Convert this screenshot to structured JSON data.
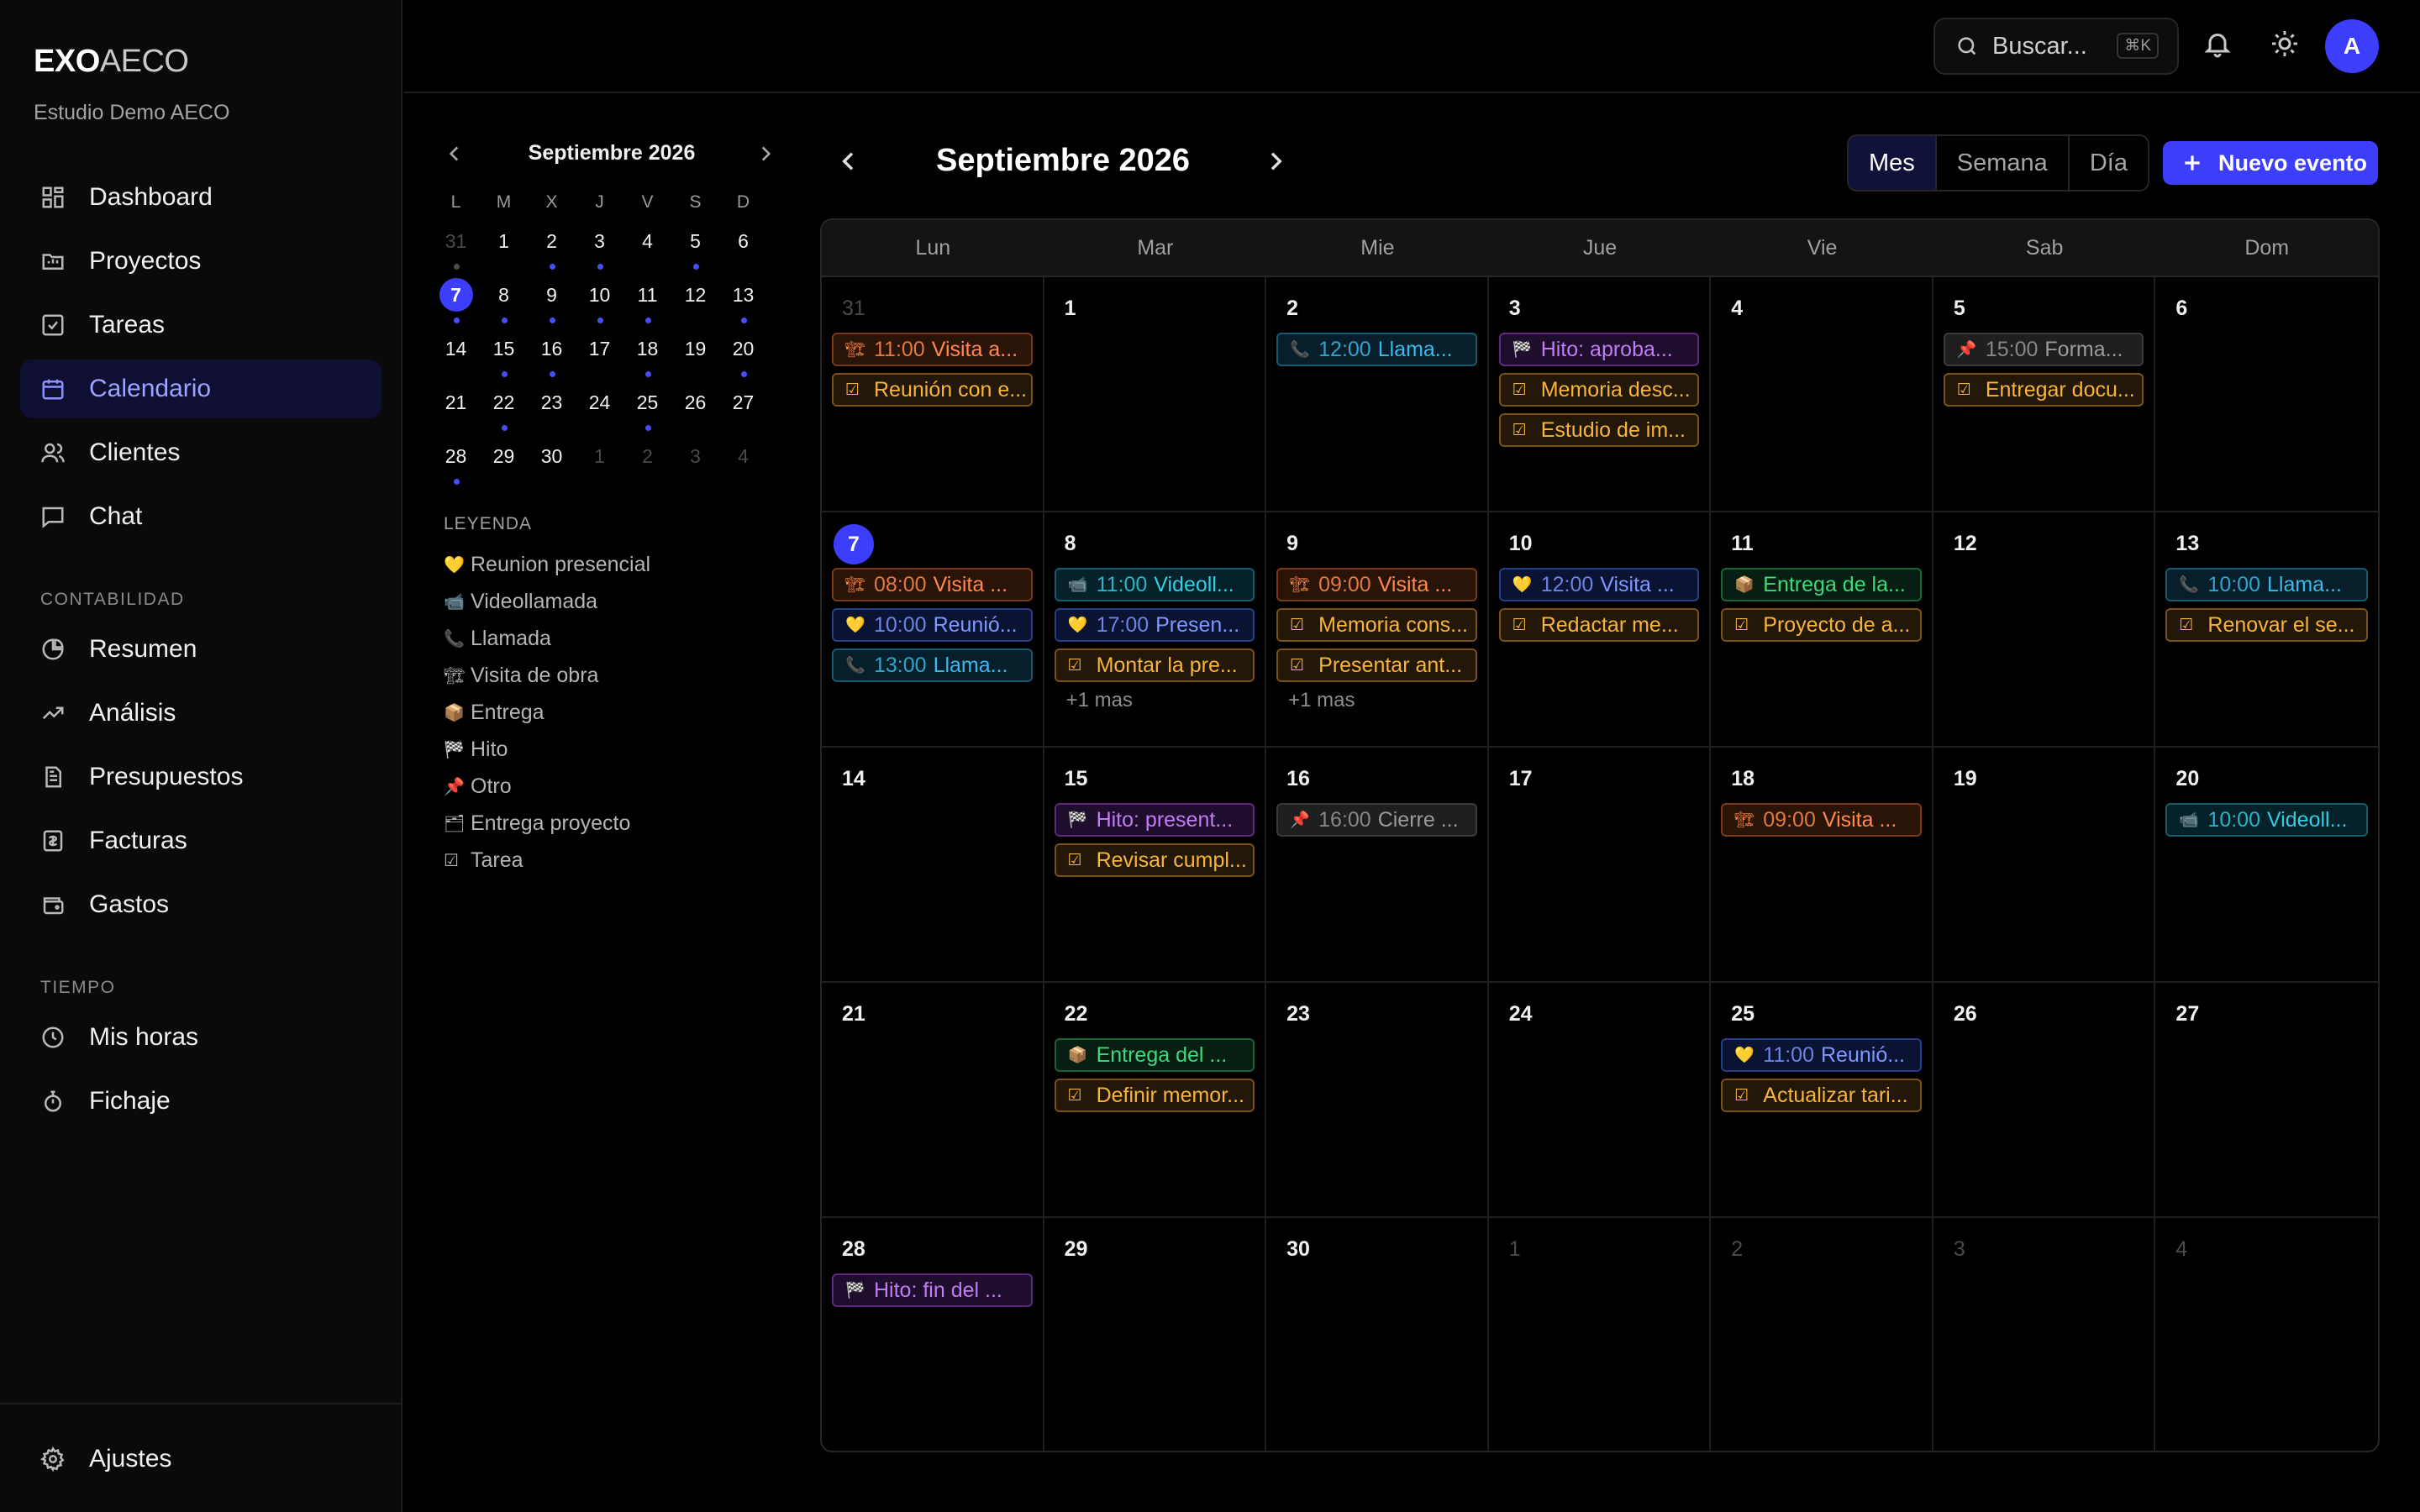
{
  "brand": {
    "bold": "EXO",
    "rest": "AECO",
    "org": "Estudio Demo AECO"
  },
  "nav": {
    "main": [
      {
        "label": "Dashboard",
        "icon": "dashboard-icon"
      },
      {
        "label": "Proyectos",
        "icon": "folder-icon"
      },
      {
        "label": "Tareas",
        "icon": "checkbox-icon"
      },
      {
        "label": "Calendario",
        "icon": "calendar-icon",
        "active": true
      },
      {
        "label": "Clientes",
        "icon": "users-icon"
      },
      {
        "label": "Chat",
        "icon": "chat-icon"
      }
    ],
    "section_contabilidad": "CONTABILIDAD",
    "contabilidad": [
      {
        "label": "Resumen",
        "icon": "pie-icon"
      },
      {
        "label": "Análisis",
        "icon": "trend-icon"
      },
      {
        "label": "Presupuestos",
        "icon": "document-icon"
      },
      {
        "label": "Facturas",
        "icon": "invoice-icon"
      },
      {
        "label": "Gastos",
        "icon": "wallet-icon"
      }
    ],
    "section_tiempo": "TIEMPO",
    "tiempo": [
      {
        "label": "Mis horas",
        "icon": "clock-icon"
      },
      {
        "label": "Fichaje",
        "icon": "stopwatch-icon"
      }
    ],
    "settings": "Ajustes"
  },
  "topbar": {
    "search_placeholder": "Buscar...",
    "shortcut": "⌘K",
    "avatar": "A"
  },
  "mini": {
    "title": "Septiembre 2026",
    "dow": [
      "L",
      "M",
      "X",
      "J",
      "V",
      "S",
      "D"
    ],
    "days": [
      {
        "n": "31",
        "m": true,
        "d": true
      },
      {
        "n": "1"
      },
      {
        "n": "2",
        "d": true
      },
      {
        "n": "3",
        "d": true
      },
      {
        "n": "4"
      },
      {
        "n": "5",
        "d": true
      },
      {
        "n": "6"
      },
      {
        "n": "7",
        "t": true,
        "d": true
      },
      {
        "n": "8",
        "d": true
      },
      {
        "n": "9",
        "d": true
      },
      {
        "n": "10",
        "d": true
      },
      {
        "n": "11",
        "d": true
      },
      {
        "n": "12"
      },
      {
        "n": "13",
        "d": true
      },
      {
        "n": "14"
      },
      {
        "n": "15",
        "d": true
      },
      {
        "n": "16",
        "d": true
      },
      {
        "n": "17"
      },
      {
        "n": "18",
        "d": true
      },
      {
        "n": "19"
      },
      {
        "n": "20",
        "d": true
      },
      {
        "n": "21"
      },
      {
        "n": "22",
        "d": true
      },
      {
        "n": "23"
      },
      {
        "n": "24"
      },
      {
        "n": "25",
        "d": true
      },
      {
        "n": "26"
      },
      {
        "n": "27"
      },
      {
        "n": "28",
        "d": true
      },
      {
        "n": "29"
      },
      {
        "n": "30"
      },
      {
        "n": "1",
        "m": true
      },
      {
        "n": "2",
        "m": true
      },
      {
        "n": "3",
        "m": true
      },
      {
        "n": "4",
        "m": true
      }
    ]
  },
  "legend": {
    "title": "LEYENDA",
    "items": [
      {
        "icon": "💛",
        "label": "Reunion presencial"
      },
      {
        "icon": "📹",
        "label": "Videollamada"
      },
      {
        "icon": "📞",
        "label": "Llamada"
      },
      {
        "icon": "🏗",
        "label": "Visita de obra"
      },
      {
        "icon": "📦",
        "label": "Entrega"
      },
      {
        "icon": "🏁",
        "label": "Hito"
      },
      {
        "icon": "📌",
        "label": "Otro"
      },
      {
        "icon": "🗂",
        "label": "Entrega proyecto"
      },
      {
        "icon": "☑",
        "label": "Tarea"
      }
    ]
  },
  "calendar": {
    "title": "Septiembre 2026",
    "views": [
      "Mes",
      "Semana",
      "Día"
    ],
    "active_view": "Mes",
    "new_event": "Nuevo evento",
    "dow": [
      "Lun",
      "Mar",
      "Mie",
      "Jue",
      "Vie",
      "Sab",
      "Dom"
    ],
    "weeks": [
      [
        {
          "n": "31",
          "m": true,
          "ev": [
            {
              "c": "orange",
              "i": "🏗",
              "t": "11:00",
              "x": "Visita a..."
            },
            {
              "c": "task",
              "i": "☑",
              "x": "Reunión con e..."
            }
          ]
        },
        {
          "n": "1",
          "ev": []
        },
        {
          "n": "2",
          "ev": [
            {
              "c": "cyan",
              "i": "📞",
              "t": "12:00",
              "x": "Llama..."
            }
          ]
        },
        {
          "n": "3",
          "ev": [
            {
              "c": "purple",
              "i": "🏁",
              "x": "Hito: aproba..."
            },
            {
              "c": "task",
              "i": "☑",
              "x": "Memoria desc..."
            },
            {
              "c": "task",
              "i": "☑",
              "x": "Estudio de im..."
            }
          ]
        },
        {
          "n": "4",
          "ev": []
        },
        {
          "n": "5",
          "ev": [
            {
              "c": "gray",
              "i": "📌",
              "t": "15:00",
              "x": "Forma..."
            },
            {
              "c": "task",
              "i": "☑",
              "x": "Entregar docu..."
            }
          ]
        },
        {
          "n": "6",
          "ev": []
        }
      ],
      [
        {
          "n": "7",
          "today": true,
          "ev": [
            {
              "c": "orange",
              "i": "🏗",
              "t": "08:00",
              "x": "Visita ..."
            },
            {
              "c": "blue",
              "i": "💛",
              "t": "10:00",
              "x": "Reunió..."
            },
            {
              "c": "cyan",
              "i": "📞",
              "t": "13:00",
              "x": "Llama..."
            }
          ]
        },
        {
          "n": "8",
          "ev": [
            {
              "c": "teal",
              "i": "📹",
              "t": "11:00",
              "x": "Videoll..."
            },
            {
              "c": "blue",
              "i": "💛",
              "t": "17:00",
              "x": "Presen..."
            },
            {
              "c": "task",
              "i": "☑",
              "x": "Montar la pre..."
            }
          ],
          "more": "+1 mas"
        },
        {
          "n": "9",
          "ev": [
            {
              "c": "orange",
              "i": "🏗",
              "t": "09:00",
              "x": "Visita ..."
            },
            {
              "c": "task",
              "i": "☑",
              "x": "Memoria cons..."
            },
            {
              "c": "task",
              "i": "☑",
              "x": "Presentar ant..."
            }
          ],
          "more": "+1 mas"
        },
        {
          "n": "10",
          "ev": [
            {
              "c": "blue",
              "i": "💛",
              "t": "12:00",
              "x": "Visita ..."
            },
            {
              "c": "task",
              "i": "☑",
              "x": "Redactar me..."
            }
          ]
        },
        {
          "n": "11",
          "ev": [
            {
              "c": "green",
              "i": "📦",
              "x": "Entrega de la..."
            },
            {
              "c": "task",
              "i": "☑",
              "x": "Proyecto de a..."
            }
          ]
        },
        {
          "n": "12",
          "ev": []
        },
        {
          "n": "13",
          "ev": [
            {
              "c": "cyan",
              "i": "📞",
              "t": "10:00",
              "x": "Llama..."
            },
            {
              "c": "task",
              "i": "☑",
              "x": "Renovar el se..."
            }
          ]
        }
      ],
      [
        {
          "n": "14",
          "ev": []
        },
        {
          "n": "15",
          "ev": [
            {
              "c": "purple",
              "i": "🏁",
              "x": "Hito: present..."
            },
            {
              "c": "task",
              "i": "☑",
              "x": "Revisar cumpl..."
            }
          ]
        },
        {
          "n": "16",
          "ev": [
            {
              "c": "gray",
              "i": "📌",
              "t": "16:00",
              "x": "Cierre ..."
            }
          ]
        },
        {
          "n": "17",
          "ev": []
        },
        {
          "n": "18",
          "ev": [
            {
              "c": "orange",
              "i": "🏗",
              "t": "09:00",
              "x": "Visita ..."
            }
          ]
        },
        {
          "n": "19",
          "ev": []
        },
        {
          "n": "20",
          "ev": [
            {
              "c": "teal",
              "i": "📹",
              "t": "10:00",
              "x": "Videoll..."
            }
          ]
        }
      ],
      [
        {
          "n": "21",
          "ev": []
        },
        {
          "n": "22",
          "ev": [
            {
              "c": "green",
              "i": "📦",
              "x": "Entrega del ..."
            },
            {
              "c": "task",
              "i": "☑",
              "x": "Definir memor..."
            }
          ]
        },
        {
          "n": "23",
          "ev": []
        },
        {
          "n": "24",
          "ev": []
        },
        {
          "n": "25",
          "ev": [
            {
              "c": "blue",
              "i": "💛",
              "t": "11:00",
              "x": "Reunió..."
            },
            {
              "c": "task",
              "i": "☑",
              "x": "Actualizar tari..."
            }
          ]
        },
        {
          "n": "26",
          "ev": []
        },
        {
          "n": "27",
          "ev": []
        }
      ],
      [
        {
          "n": "28",
          "ev": [
            {
              "c": "purple",
              "i": "🏁",
              "x": "Hito: fin del ..."
            }
          ]
        },
        {
          "n": "29",
          "ev": []
        },
        {
          "n": "30",
          "ev": []
        },
        {
          "n": "1",
          "m": true,
          "ev": []
        },
        {
          "n": "2",
          "m": true,
          "ev": []
        },
        {
          "n": "3",
          "m": true,
          "ev": []
        },
        {
          "n": "4",
          "m": true,
          "ev": []
        }
      ]
    ]
  }
}
